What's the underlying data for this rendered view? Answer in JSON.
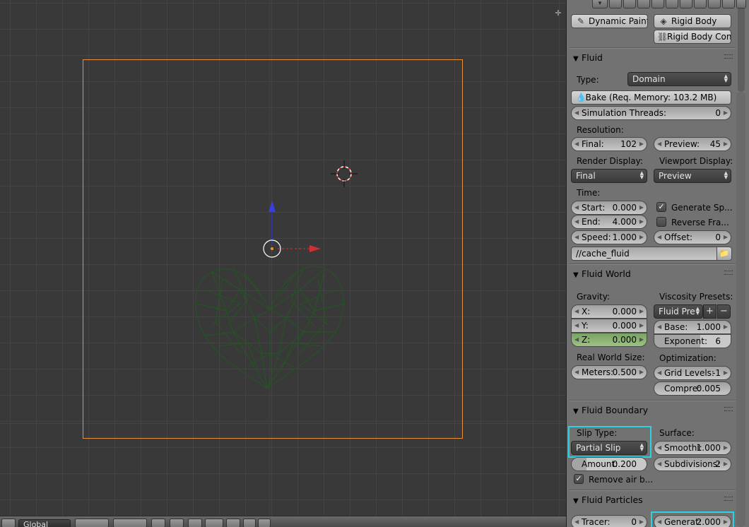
{
  "properties": {
    "top_buttons": {
      "dynamic_paint": "Dynamic Paint",
      "rigid_body": "Rigid Body",
      "rigid_body_constraint": "Rigid Body Con..."
    },
    "fluid": {
      "header": "Fluid",
      "type_label": "Type:",
      "type_value": "Domain",
      "bake_label": "Bake (Req. Memory: 103.2 MB)",
      "threads_label": "Simulation Threads:",
      "threads_value": "0",
      "resolution_label": "Resolution:",
      "final_label": "Final:",
      "final_value": "102",
      "preview_label": "Preview:",
      "preview_value": "45",
      "render_display_label": "Render Display:",
      "render_display_value": "Final",
      "viewport_display_label": "Viewport Display:",
      "viewport_display_value": "Preview",
      "time_label": "Time:",
      "start_label": "Start:",
      "start_value": "0.000",
      "end_label": "End:",
      "end_value": "4.000",
      "speed_label": "Speed:",
      "speed_value": "1.000",
      "offset_label": "Offset:",
      "offset_value": "0",
      "generate_speed_label": "Generate Sp...",
      "generate_speed_checked": true,
      "reverse_frames_label": "Reverse Fra...",
      "reverse_frames_checked": false,
      "cache_path": "//cache_fluid"
    },
    "fluid_world": {
      "header": "Fluid World",
      "gravity_label": "Gravity:",
      "x_label": "X:",
      "x_value": "0.000",
      "y_label": "Y:",
      "y_value": "0.000",
      "z_label": "Z:",
      "z_value": "0.000",
      "viscosity_label": "Viscosity Presets:",
      "viscosity_preset": "Fluid Pre",
      "base_label": "Base:",
      "base_value": "1.000",
      "exponent_label": "Exponent:",
      "exponent_value": "6",
      "real_world_label": "Real World Size:",
      "meters_label": "Meters:",
      "meters_value": "0.500",
      "optimization_label": "Optimization:",
      "grid_levels_label": "Grid Levels:",
      "grid_levels_value": "-1",
      "compress_label": "Compre:",
      "compress_value": "0.005"
    },
    "fluid_boundary": {
      "header": "Fluid Boundary",
      "slip_type_label": "Slip Type:",
      "slip_type_value": "Partial Slip",
      "surface_label": "Surface:",
      "smoothing_label": "Smoothi:",
      "smoothing_value": "1.000",
      "amount_label": "Amount:",
      "amount_value": "0.200",
      "subdivisions_label": "Subdivisions:",
      "subdivisions_value": "2",
      "remove_air_label": "Remove air b...",
      "remove_air_checked": true
    },
    "fluid_particles": {
      "header": "Fluid Particles",
      "tracer_label": "Tracer:",
      "tracer_value": "0",
      "generate_label": "Generat:",
      "generate_value": "2.000"
    }
  },
  "view_header": {
    "orientation_value": "Global"
  },
  "colors": {
    "highlight": "#29d3e3",
    "camera_frame": "#e8903a",
    "mesh_wire": "#1f5a1f",
    "z_axis": "#2c2fbf"
  }
}
